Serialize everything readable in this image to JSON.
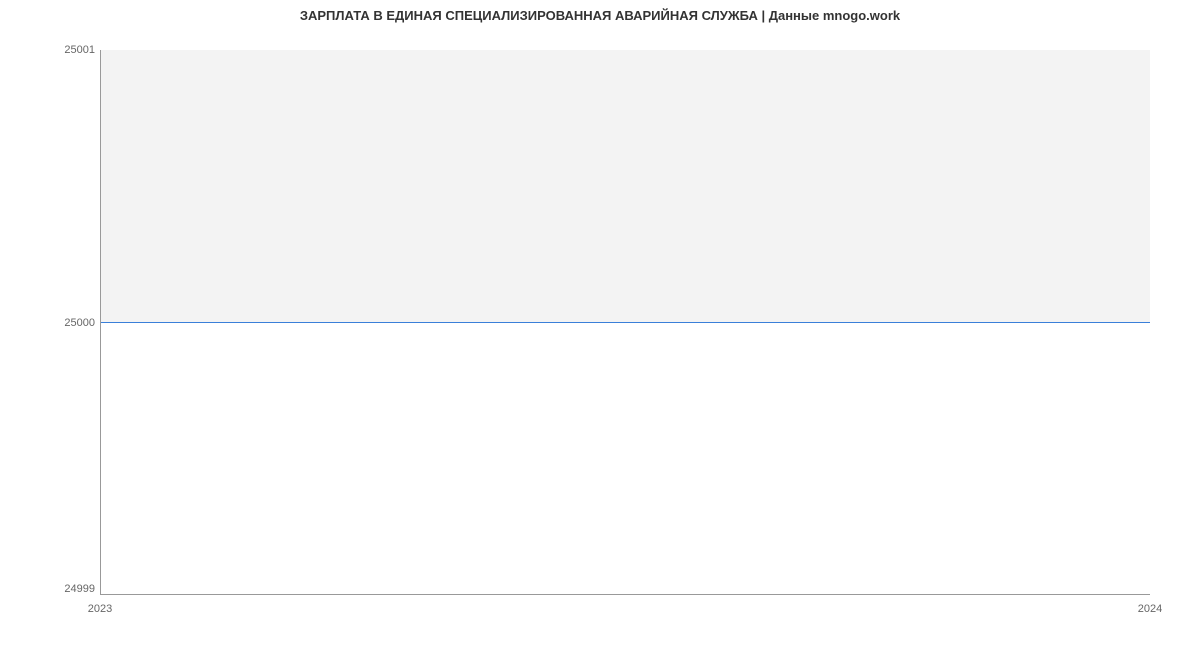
{
  "chart_data": {
    "type": "line",
    "title": "ЗАРПЛАТА В ЕДИНАЯ СПЕЦИАЛИЗИРОВАННАЯ АВАРИЙНАЯ СЛУЖБА | Данные mnogo.work",
    "x": [
      2023,
      2024
    ],
    "values": [
      25000,
      25000
    ],
    "xlabel": "",
    "ylabel": "",
    "ylim": [
      24999,
      25001
    ],
    "y_ticks": [
      24999,
      25000,
      25001
    ],
    "x_ticks": [
      2023,
      2024
    ],
    "line_color": "#3a7fd9",
    "upper_bg": "#f3f3f3"
  },
  "labels": {
    "y_top": "25001",
    "y_mid": "25000",
    "y_bot": "24999",
    "x_left": "2023",
    "x_right": "2024"
  }
}
